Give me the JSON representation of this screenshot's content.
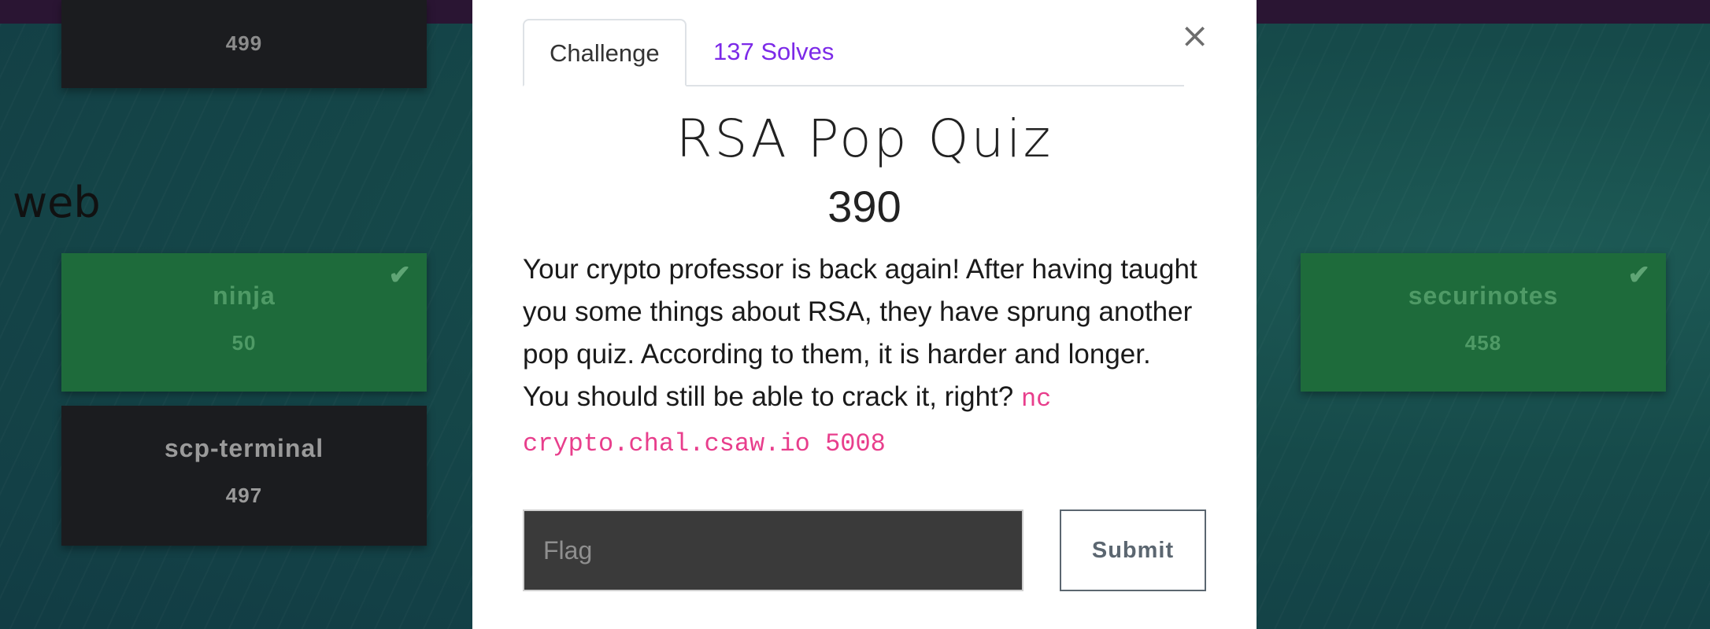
{
  "board": {
    "top_card": {
      "points": "499"
    },
    "section": {
      "title": "web"
    },
    "cards": [
      {
        "name": "ninja",
        "points": "50",
        "solved": true
      },
      {
        "name": "scp-terminal",
        "points": "497",
        "solved": false
      },
      {
        "name": "securinotes",
        "points": "458",
        "solved": true
      }
    ],
    "check_glyph": "✔"
  },
  "modal": {
    "close_glyph": "×",
    "tabs": [
      {
        "label": "Challenge",
        "active": true
      },
      {
        "label": "137 Solves",
        "active": false
      }
    ],
    "title": "RSA Pop Quiz",
    "value": "390",
    "description": "Your crypto professor is back again! After having taught you some things about RSA, they have sprung another pop quiz. According to them, it is harder and longer. You should still be able to crack it, right? ",
    "connection": "nc crypto.chal.csaw.io 5008",
    "flag_placeholder": "Flag",
    "submit_label": "Submit"
  },
  "colors": {
    "topbar": "#2a1533",
    "solved_card": "#1e6b3b",
    "unsolved_card": "#1b1c1f",
    "tab_link": "#7c2ae8",
    "code": "#e83e8c"
  }
}
